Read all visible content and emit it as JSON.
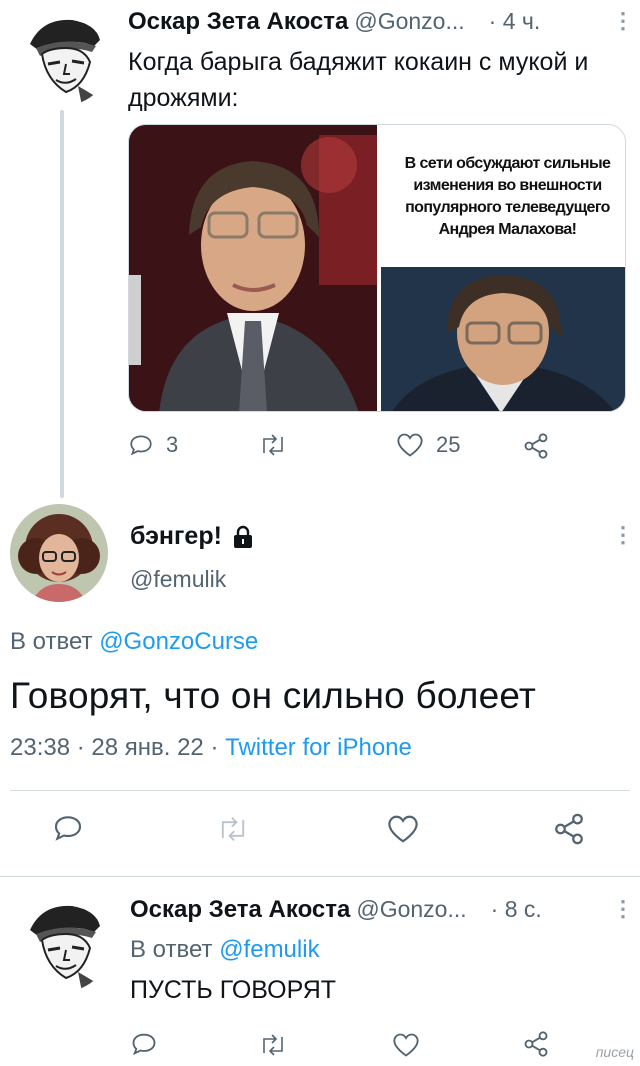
{
  "tweet1": {
    "author": "Оскар Зета Акоста",
    "handle": "@Gonzo...",
    "time": "· 4 ч.",
    "text": "Когда барыга бадяжит кокаин с мукой и дрожями:",
    "media_caption": "В сети обсуждают сильные изменения во внешности популярного телеведущего Андрея Малахова!",
    "replies": "3",
    "likes": "25"
  },
  "tweet2": {
    "author": "бэнгер!",
    "handle": "@femulik",
    "reply_prefix": "В ответ",
    "reply_to": "@GonzoCurse",
    "text": "Говорят, что он сильно болеет",
    "time": "23:38 · 28 янв. 22 ·",
    "source": "Twitter for iPhone"
  },
  "tweet3": {
    "author": "Оскар Зета Акоста",
    "handle": "@Gonzo...",
    "time": "· 8 с.",
    "reply_prefix": "В ответ",
    "reply_to": "@femulik",
    "text": "ПУСТЬ ГОВОРЯТ"
  },
  "kebab": "⋮",
  "watermark": "писец",
  "icons": {
    "reply": "reply-icon",
    "retweet": "retweet-icon",
    "like": "heart-icon",
    "share": "share-icon",
    "lock": "lock-icon",
    "more": "more-icon"
  },
  "colors": {
    "link": "#1d9bf0",
    "secondary": "#536471",
    "thread_line": "#cfd9de"
  }
}
